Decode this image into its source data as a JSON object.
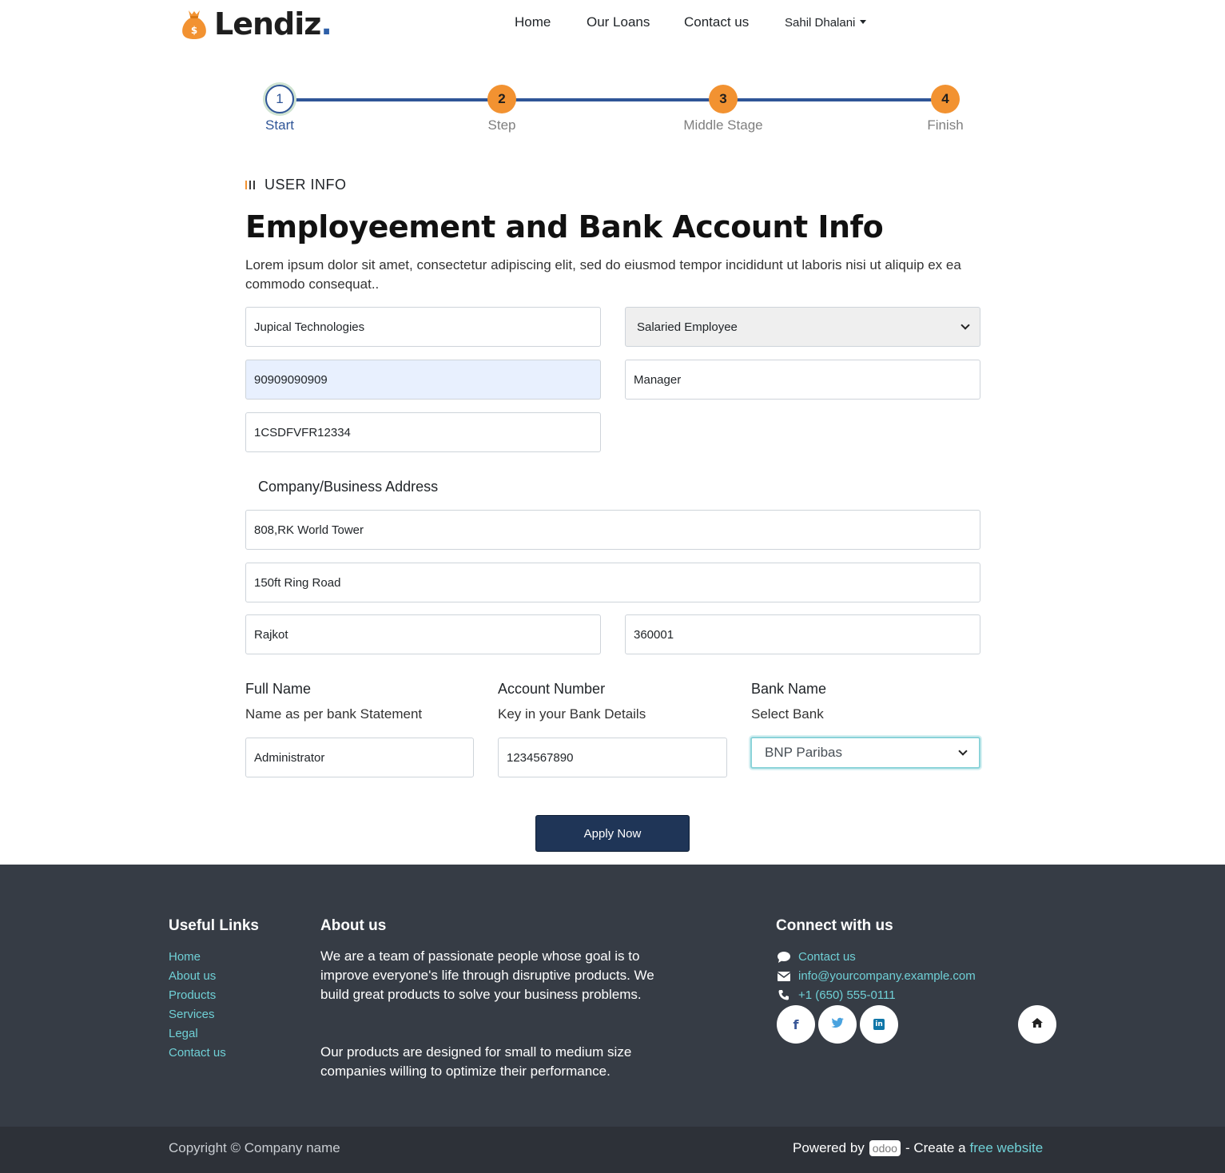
{
  "brand": {
    "name": "Lendiz",
    "dot": "."
  },
  "nav": {
    "items": [
      "Home",
      "Our Loans",
      "Contact us"
    ],
    "user": "Sahil Dhalani"
  },
  "stepper": {
    "steps": [
      {
        "number": "1",
        "label": "Start",
        "state": "active"
      },
      {
        "number": "2",
        "label": "Step",
        "state": "pending"
      },
      {
        "number": "3",
        "label": "Middle Stage",
        "state": "pending"
      },
      {
        "number": "4",
        "label": "Finish",
        "state": "pending"
      }
    ]
  },
  "section": {
    "tag": "USER INFO",
    "title": "Employeement and Bank Account Info",
    "description": "Lorem ipsum dolor sit amet, consectetur adipiscing elit, sed do eiusmod tempor incididunt ut laboris nisi ut aliquip ex ea commodo consequat.."
  },
  "form": {
    "company_name": "Jupical Technologies",
    "employment_type": "Salaried Employee",
    "phone": "90909090909",
    "designation": "Manager",
    "pan": "1CSDFVFR12334",
    "address_heading": "Company/Business Address",
    "address_line1": "808,RK World Tower",
    "address_line2": "150ft Ring Road",
    "city": "Rajkot",
    "zip": "360001",
    "full_name": {
      "title": "Full Name",
      "subtitle": "Name as per bank Statement",
      "value": "Administrator"
    },
    "account_number": {
      "title": "Account Number",
      "subtitle": "Key in your Bank Details",
      "value": "1234567890"
    },
    "bank_name": {
      "title": "Bank Name",
      "subtitle": "Select Bank",
      "value": "BNP Paribas"
    },
    "submit_label": "Apply Now"
  },
  "footer": {
    "useful_links": {
      "title": "Useful Links",
      "items": [
        "Home",
        "About us",
        "Products",
        "Services",
        "Legal",
        "Contact us"
      ]
    },
    "about": {
      "title": "About us",
      "para1": "We are a team of passionate people whose goal is to improve everyone's life through disruptive products. We build great products to solve your business problems.",
      "para2": "Our products are designed for small to medium size companies willing to optimize their performance."
    },
    "connect": {
      "title": "Connect with us",
      "contact": "Contact us",
      "email": "info@yourcompany.example.com",
      "phone": "+1 (650) 555-0111"
    },
    "copyright": "Copyright © Company name",
    "powered_by": "Powered by",
    "odoo": "odoo",
    "create_a": "- Create a",
    "free_website": "free website"
  },
  "colors": {
    "accent_orange": "#f29231",
    "stepper_blue": "#2f5597",
    "button_navy": "#1f3557",
    "footer_bg": "#363c45",
    "link_teal": "#6fd0d6"
  }
}
